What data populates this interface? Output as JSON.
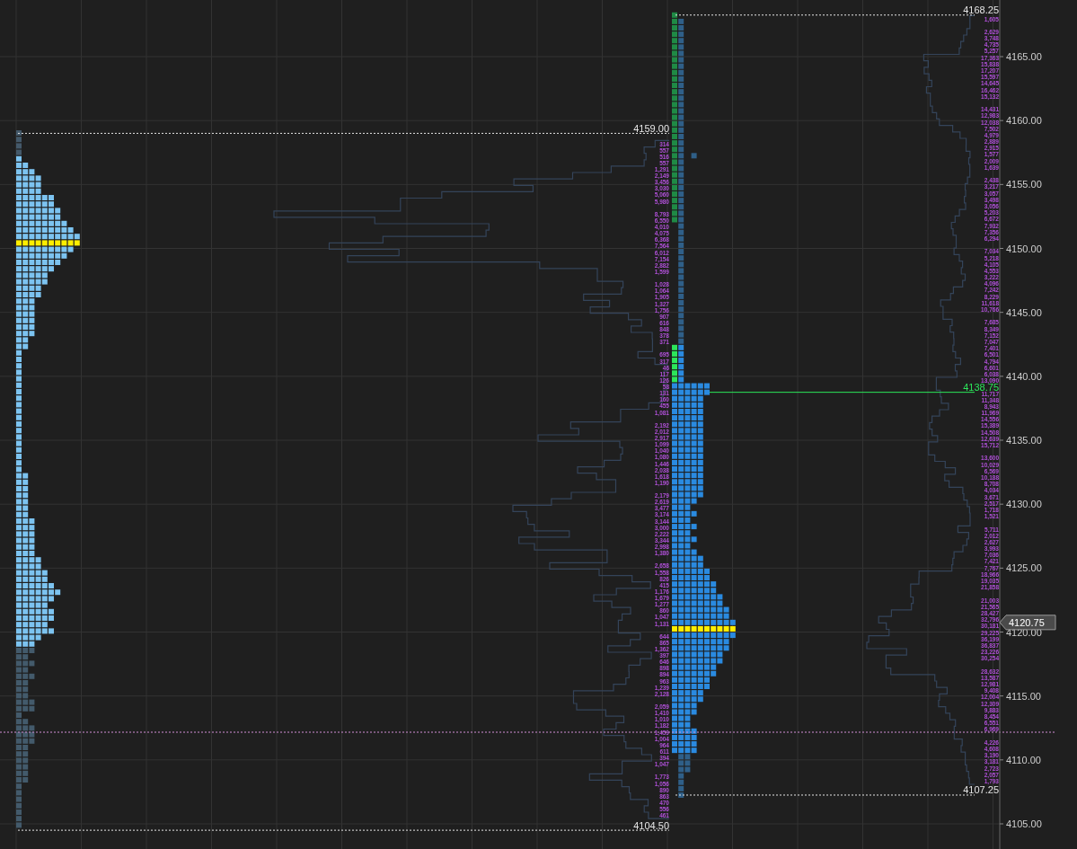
{
  "price_axis": {
    "ticks": [
      "4165.00",
      "4160.00",
      "4155.00",
      "4150.00",
      "4145.00",
      "4140.00",
      "4135.00",
      "4130.00",
      "4125.00",
      "4120.00",
      "4115.00",
      "4110.00",
      "4105.00"
    ],
    "last_price": "4120.75"
  },
  "left_levels": [
    {
      "text": "4159.00",
      "kind": "extreme"
    },
    {
      "text": "4104.50",
      "kind": "extreme"
    }
  ],
  "right_levels": [
    {
      "text": "4168.25",
      "kind": "extreme"
    },
    {
      "text": "4138.75",
      "kind": "close"
    },
    {
      "text": "4107.25",
      "kind": "extreme"
    }
  ],
  "left_volumes": {
    "groups": [
      [
        "314",
        "557",
        "516",
        "557",
        "1,291",
        "2,149",
        "3,456",
        "3,030",
        "5,060",
        "5,980"
      ],
      [
        "8,793",
        "6,550",
        "4,010",
        "4,075",
        "6,368",
        "7,564",
        "6,012",
        "7,154",
        "2,882",
        "1,599"
      ],
      [
        "1,028",
        "1,064",
        "1,905",
        "1,327",
        "1,756",
        "907",
        "616",
        "848",
        "378",
        "371"
      ],
      [
        "695",
        "317",
        "46",
        "117",
        "126",
        "58",
        "131",
        "160",
        "455",
        "1,081"
      ],
      [
        "2,192",
        "2,012",
        "2,917",
        "1,099",
        "1,040",
        "1,080",
        "1,446",
        "2,038",
        "1,618",
        "1,190"
      ],
      [
        "2,179",
        "2,619",
        "3,477",
        "3,174",
        "3,144",
        "3,000",
        "2,222",
        "3,344",
        "2,998",
        "1,380"
      ],
      [
        "2,658",
        "1,558",
        "826",
        "415",
        "1,176",
        "1,679",
        "1,277",
        "860",
        "1,047",
        "1,131"
      ],
      [
        "644",
        "865",
        "1,362",
        "397",
        "646",
        "898",
        "894",
        "963",
        "1,239",
        "2,128"
      ],
      [
        "2,059",
        "1,410",
        "1,010",
        "1,182",
        "1,459",
        "1,004",
        "964",
        "611",
        "394",
        "1,047"
      ],
      [
        "1,773",
        "1,056",
        "890",
        "863",
        "470",
        "556",
        "461"
      ]
    ]
  },
  "right_volumes": {
    "groups": [
      [
        "1,605"
      ],
      [
        "2,629",
        "3,748",
        "4,735",
        "5,257",
        "17,363",
        "15,838",
        "17,207",
        "15,597",
        "14,645",
        "16,462",
        "15,132"
      ],
      [
        "14,431",
        "12,983",
        "12,038",
        "7,502",
        "4,979",
        "2,889",
        "2,915",
        "1,577",
        "2,009",
        "1,639"
      ],
      [
        "2,438",
        "3,217",
        "3,057",
        "3,498",
        "3,056",
        "5,203",
        "6,672",
        "7,932",
        "7,356",
        "6,294"
      ],
      [
        "7,034",
        "5,218",
        "4,105",
        "4,553",
        "3,222",
        "4,096",
        "7,242",
        "8,229",
        "11,618",
        "10,766"
      ],
      [
        "7,685",
        "8,349",
        "7,152",
        "7,047",
        "7,401",
        "6,501",
        "4,794",
        "6,601",
        "6,038",
        "13,090"
      ],
      [
        "11,717",
        "11,348",
        "8,943",
        "11,969",
        "14,556",
        "15,389",
        "14,508",
        "12,639",
        "15,712"
      ],
      [
        "13,600",
        "10,029",
        "6,569",
        "10,188",
        "8,708",
        "4,034",
        "3,671",
        "2,517",
        "1,718",
        "1,521"
      ],
      [
        "5,711",
        "2,012",
        "2,627",
        "3,993",
        "7,036",
        "7,421",
        "7,767",
        "18,966",
        "19,035",
        "21,858"
      ],
      [
        "21,003",
        "21,565",
        "28,427",
        "32,796",
        "30,181",
        "29,225",
        "36,199",
        "36,837",
        "23,226",
        "30,254"
      ],
      [
        "28,632",
        "13,587",
        "12,981",
        "9,408",
        "12,004",
        "12,309",
        "9,883",
        "8,454",
        "6,551",
        "6,969"
      ],
      [
        "4,226",
        "4,608",
        "3,190",
        "3,181",
        "2,723",
        "2,057",
        "1,793"
      ]
    ]
  }
}
